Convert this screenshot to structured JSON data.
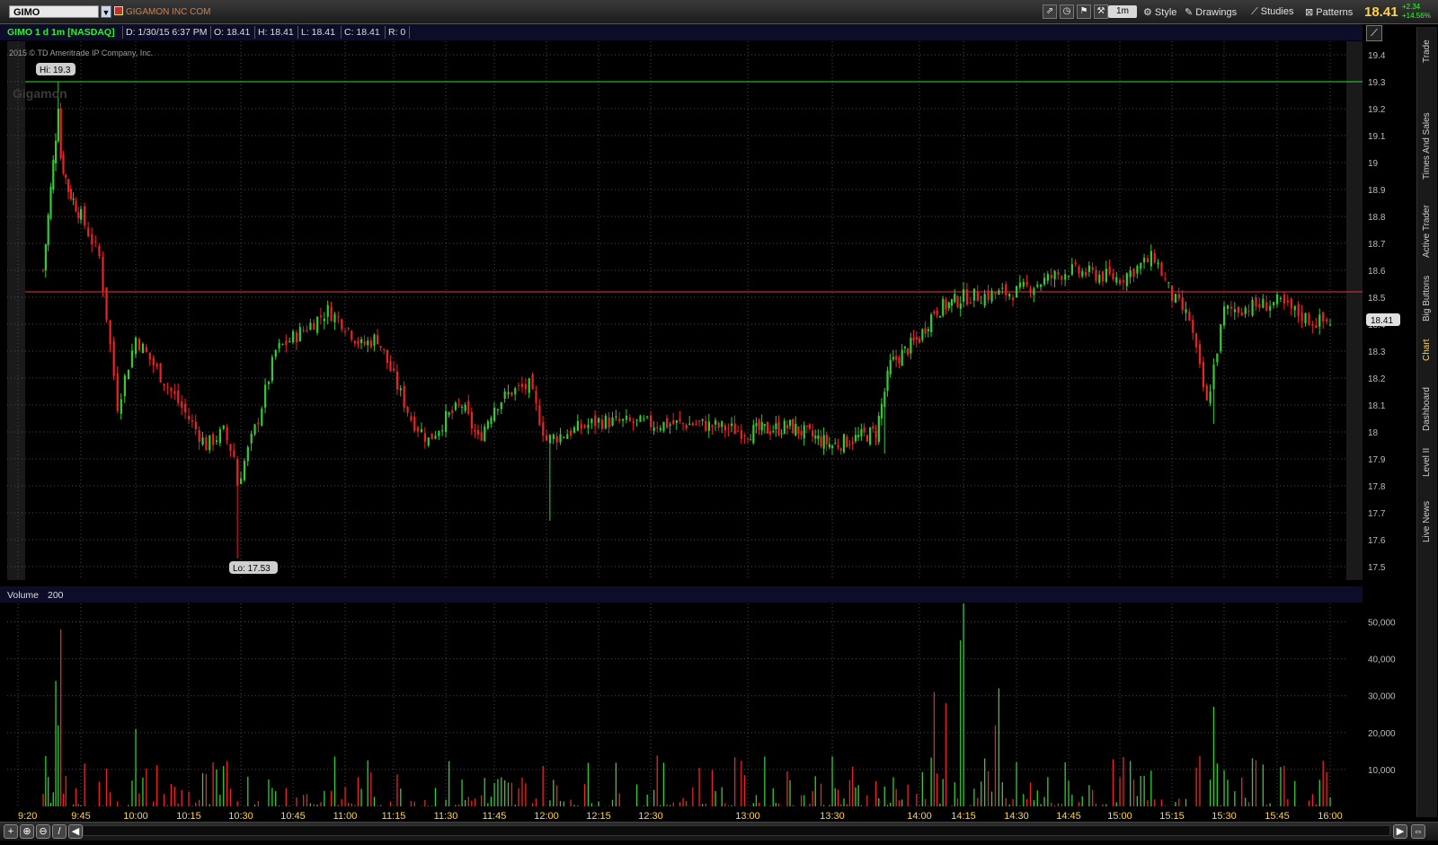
{
  "toolbar": {
    "symbol": "GIMO",
    "company": "GIGAMON INC COM",
    "aggregation": "1m",
    "style_label": "Style",
    "drawings_label": "Drawings",
    "studies_label": "Studies",
    "patterns_label": "Patterns",
    "last_price": "18.41",
    "net_change": "+2.34",
    "pct_change": "+14.56%"
  },
  "info": {
    "symbol_desc": "GIMO 1 d 1m [NASDAQ]",
    "date": "D: 1/30/15 6:37 PM",
    "open": "O: 18.41",
    "high": "H: 18.41",
    "low": "L: 18.41",
    "close": "C: 18.41",
    "range": "R: 0"
  },
  "copyright": "2015 © TD Ameritrade IP Company, Inc.",
  "watermark": "Gigamon",
  "hi_label": "Hi: 19.3",
  "lo_label": "Lo: 17.53",
  "price_bubble": "18.41",
  "volume_label": "Volume",
  "volume_length": "200",
  "side_tabs": [
    "Trade",
    "Times And Sales",
    "Active Trader",
    "Big Buttons",
    "Chart",
    "Dashboard",
    "Level II",
    "Live News"
  ],
  "colors": {
    "up": "#33cc33",
    "down": "#ee2222",
    "hi_line": "#33dd33",
    "ref_line": "#ee3333",
    "accent": "#ffd24a"
  },
  "chart_data": {
    "type": "candlestick",
    "x_ticks": [
      "9:20",
      "9:45",
      "10:00",
      "10:15",
      "10:30",
      "10:45",
      "11:00",
      "11:15",
      "11:30",
      "11:45",
      "12:00",
      "12:15",
      "12:30",
      "13:00",
      "13:30",
      "14:00",
      "14:15",
      "14:30",
      "14:45",
      "15:00",
      "15:15",
      "15:30",
      "15:45",
      "16:00"
    ],
    "y_ticks": [
      "17.5",
      "17.6",
      "17.7",
      "17.8",
      "17.9",
      "18",
      "18.1",
      "18.2",
      "18.3",
      "18.4",
      "18.5",
      "18.6",
      "18.7",
      "18.8",
      "18.9",
      "19",
      "19.1",
      "19.2",
      "19.3",
      "19.4"
    ],
    "ylim": [
      17.45,
      19.45
    ],
    "high": 19.3,
    "low": 17.53,
    "reference_line": 18.52,
    "close_series": [
      [
        "9:30",
        18.6
      ],
      [
        "9:35",
        19.1
      ],
      [
        "9:40",
        18.9
      ],
      [
        "9:45",
        18.8
      ],
      [
        "9:50",
        18.65
      ],
      [
        "9:55",
        18.1
      ],
      [
        "10:00",
        18.35
      ],
      [
        "10:05",
        18.25
      ],
      [
        "10:10",
        18.15
      ],
      [
        "10:15",
        18.05
      ],
      [
        "10:20",
        17.95
      ],
      [
        "10:25",
        18.0
      ],
      [
        "10:30",
        17.85
      ],
      [
        "10:35",
        18.05
      ],
      [
        "10:40",
        18.3
      ],
      [
        "10:45",
        18.35
      ],
      [
        "10:50",
        18.4
      ],
      [
        "10:55",
        18.45
      ],
      [
        "11:00",
        18.4
      ],
      [
        "11:05",
        18.32
      ],
      [
        "11:10",
        18.35
      ],
      [
        "11:15",
        18.2
      ],
      [
        "11:20",
        18.05
      ],
      [
        "11:25",
        17.97
      ],
      [
        "11:30",
        18.05
      ],
      [
        "11:35",
        18.1
      ],
      [
        "11:40",
        17.97
      ],
      [
        "11:45",
        18.1
      ],
      [
        "11:50",
        18.15
      ],
      [
        "11:55",
        18.17
      ],
      [
        "12:00",
        17.97
      ],
      [
        "12:15",
        18.04
      ],
      [
        "12:30",
        18.03
      ],
      [
        "12:45",
        18.03
      ],
      [
        "13:00",
        18.0
      ],
      [
        "13:15",
        18.02
      ],
      [
        "13:30",
        17.95
      ],
      [
        "13:45",
        18.0
      ],
      [
        "13:50",
        18.25
      ],
      [
        "14:00",
        18.35
      ],
      [
        "14:05",
        18.45
      ],
      [
        "14:15",
        18.5
      ],
      [
        "14:30",
        18.52
      ],
      [
        "14:45",
        18.6
      ],
      [
        "15:00",
        18.57
      ],
      [
        "15:10",
        18.65
      ],
      [
        "15:15",
        18.5
      ],
      [
        "15:20",
        18.42
      ],
      [
        "15:25",
        18.1
      ],
      [
        "15:30",
        18.45
      ],
      [
        "15:45",
        18.48
      ],
      [
        "15:55",
        18.41
      ],
      [
        "16:00",
        18.41
      ]
    ],
    "volume_ticks": [
      "10,000",
      "20,000",
      "30,000",
      "40,000",
      "50,000"
    ],
    "volume_ylim": [
      0,
      55000
    ]
  }
}
